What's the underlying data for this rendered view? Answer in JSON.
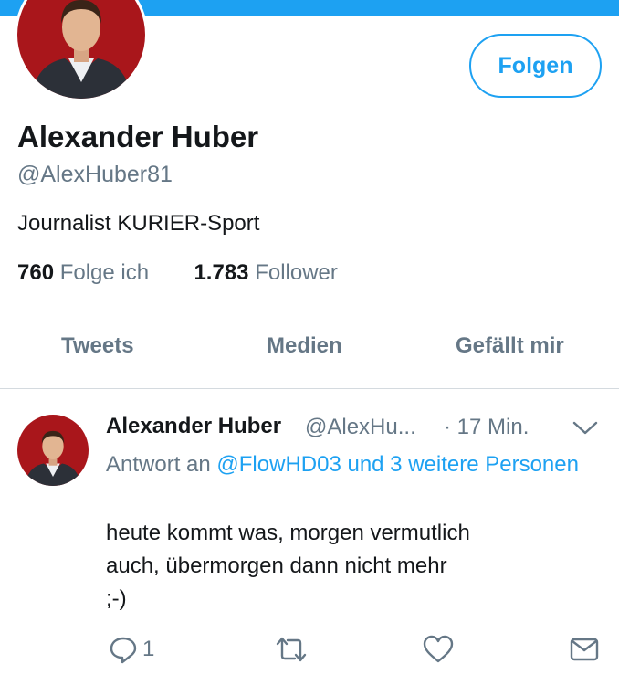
{
  "profile": {
    "name": "Alexander Huber",
    "handle": "@AlexHuber81",
    "bio": "Journalist KURIER-Sport",
    "following_count": "760",
    "following_label": "Folge ich",
    "followers_count": "1.783",
    "followers_label": "Follower",
    "follow_label": "Folgen"
  },
  "tabs": [
    "Tweets",
    "Medien",
    "Gefällt mir"
  ],
  "tweet": {
    "author_name": "Alexander Huber",
    "author_handle": "@AlexHu...",
    "time": "· 17 Min.",
    "reply_prefix": "Antwort an",
    "reply_mentions": "@FlowHD03 und 3 weitere Personen",
    "text_lines": [
      "heute kommt was, morgen vermutlich",
      "auch, übermorgen dann nicht mehr",
      ";-)"
    ],
    "reply_count": "1"
  },
  "colors": {
    "accent": "#1da1f2",
    "secondary_text": "#657786",
    "primary_text": "#14171a",
    "avatar_bg": "#a9161b"
  },
  "icons": {
    "reply": "reply-icon",
    "retweet": "retweet-icon",
    "like": "heart-icon",
    "message": "message-icon",
    "more": "chevron-down-icon"
  }
}
